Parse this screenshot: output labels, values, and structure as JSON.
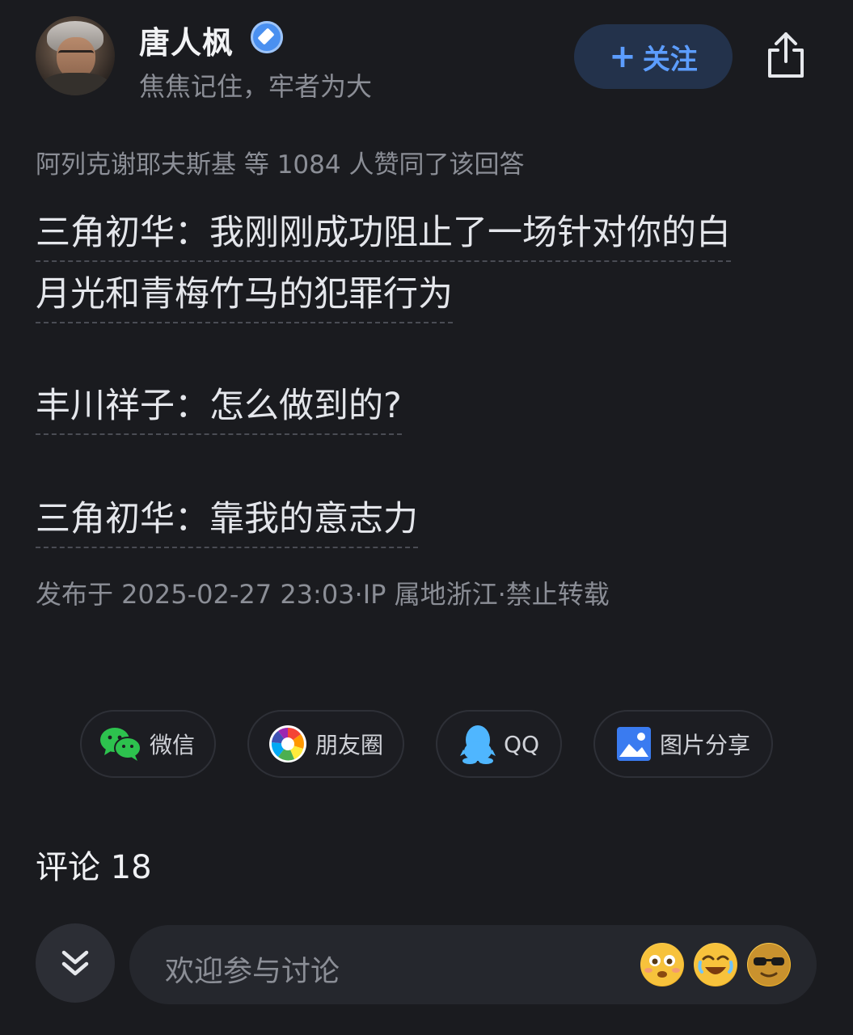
{
  "author": {
    "name": "唐人枫",
    "bio": "焦焦记住，牢者为大"
  },
  "actions": {
    "follow_label": "关注",
    "follow_plus": "+"
  },
  "likes": {
    "text": "阿列克谢耶夫斯基 等 1084 人赞同了该回答"
  },
  "content": {
    "line1": "三角初华：我刚刚成功阻止了一场针对你的白",
    "line2": "月光和青梅竹马的犯罪行为",
    "line3": "丰川祥子：怎么做到的?",
    "line4": "三角初华：靠我的意志力"
  },
  "meta": {
    "publish": "发布于 2025-02-27 23:03·IP 属地浙江·禁止转载"
  },
  "share": {
    "wechat": "微信",
    "moments": "朋友圈",
    "qq": "QQ",
    "image": "图片分享"
  },
  "comments": {
    "title": "评论 18"
  },
  "comment_bar": {
    "placeholder": "欢迎参与讨论"
  },
  "colors": {
    "background": "#1a1b1f",
    "accent": "#5c9dff",
    "follow_bg": "#23324b",
    "wechat_green": "#2dc24e",
    "qq_blue": "#4fb6ff",
    "image_blue": "#3a7bf0"
  }
}
